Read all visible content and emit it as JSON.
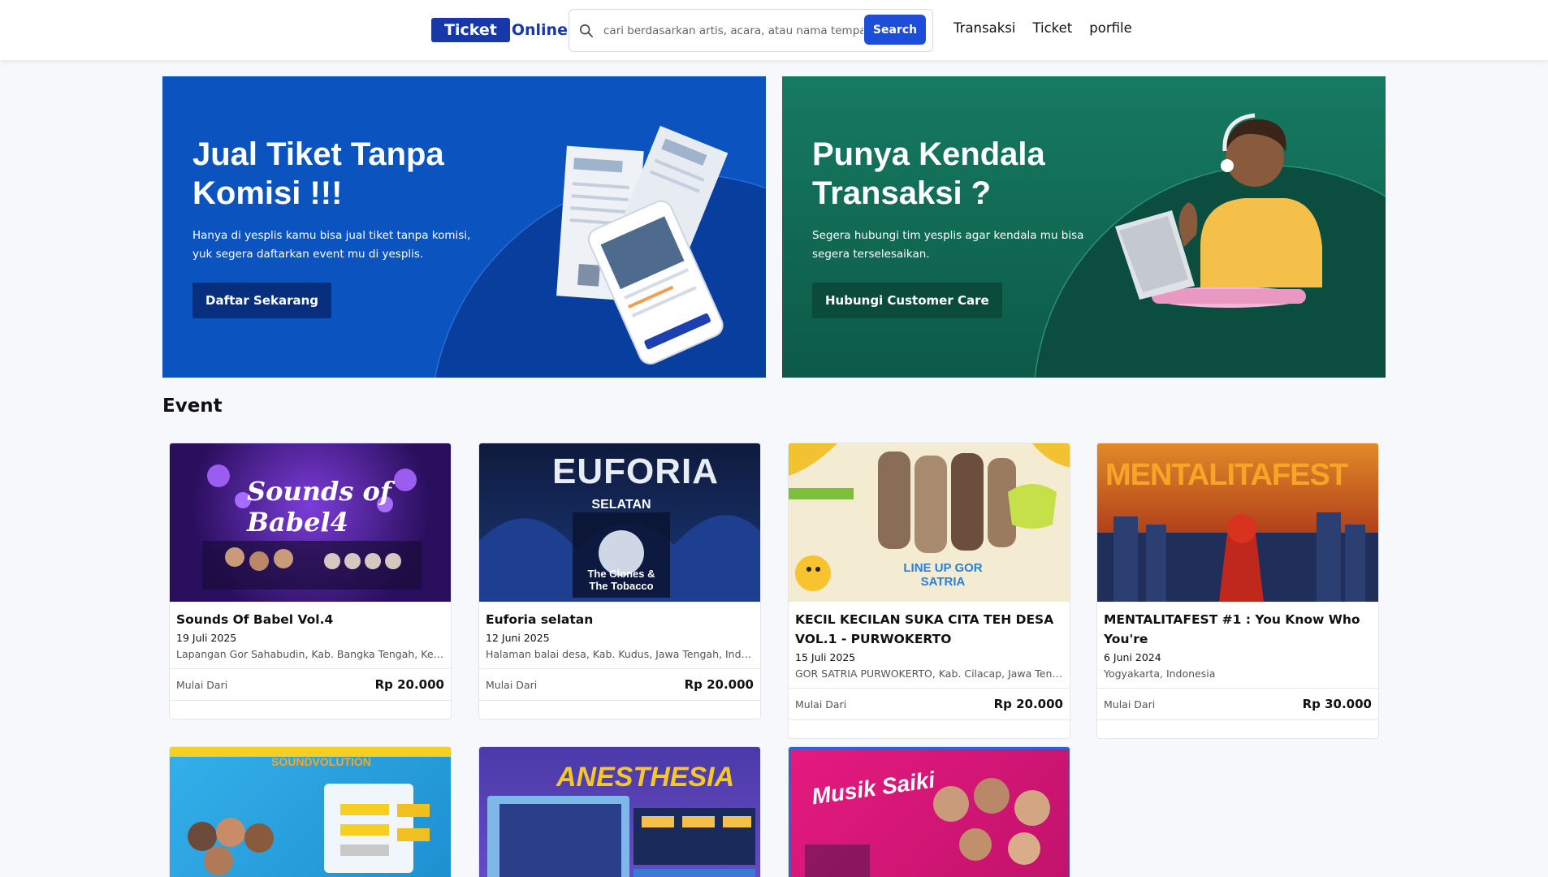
{
  "header": {
    "logo_box": "Ticket",
    "logo_text": "Online",
    "search_placeholder": "cari berdasarkan artis, acara, atau nama tempat",
    "search_button": "Search",
    "nav": [
      "Transaksi",
      "Ticket",
      "porfile"
    ]
  },
  "banners": [
    {
      "title_line1": "Jual Tiket Tanpa",
      "title_line2": "Komisi !!!",
      "text": "Hanya di yesplis kamu bisa jual tiket tanpa komisi, yuk segera daftarkan event mu di yesplis.",
      "button": "Daftar Sekarang"
    },
    {
      "title_line1": "Punya Kendala",
      "title_line2": "Transaksi ?",
      "text": "Segera hubungi tim yesplis agar kendala mu bisa segera terselesaikan.",
      "button": "Hubungi Customer Care"
    }
  ],
  "section_title": "Event",
  "events": [
    {
      "title": "Sounds Of Babel Vol.4",
      "date": "19 Juli 2025",
      "location": "Lapangan Gor Sahabudin, Kab. Bangka Tengah, Kepulauan Bangka Belitung, Indonesia",
      "from_label": "Mulai Dari",
      "price": "Rp 20.000",
      "poster_text": "Sounds of Babel4",
      "color": "#3b1a78"
    },
    {
      "title": "Euforia selatan",
      "date": "12 Juni 2025",
      "location": "Halaman balai desa, Kab. Kudus, Jawa Tengah, Indonesia",
      "from_label": "Mulai Dari",
      "price": "Rp 20.000",
      "poster_text": "EUFORIA",
      "color": "#12234f"
    },
    {
      "title": "KECIL KECILAN SUKA CITA TEH DESA VOL.1 - PURWOKERTO",
      "date": "15 Juli 2025",
      "location": "GOR SATRIA PURWOKERTO, Kab. Cilacap, Jawa Tengah, Indonesia",
      "from_label": "Mulai Dari",
      "price": "Rp 20.000",
      "poster_text": "LINE UP GOR SATRIA",
      "color": "#f1e9c8"
    },
    {
      "title": "MENTALITAFEST #1 : You Know Who You're",
      "date": "6 Juni 2024",
      "location": "Yogyakarta, Indonesia",
      "from_label": "Mulai Dari",
      "price": "Rp 30.000",
      "poster_text": "MENTALITAFEST",
      "color": "#c2501c"
    }
  ],
  "events_row2": [
    {
      "poster_text": "SOUNDVOLUTION",
      "color": "#2aa6e0"
    },
    {
      "poster_text": "ANESTHESIA",
      "color": "#3a2f8f"
    },
    {
      "poster_text": "Musik Saiki",
      "color": "#e0197a"
    }
  ]
}
